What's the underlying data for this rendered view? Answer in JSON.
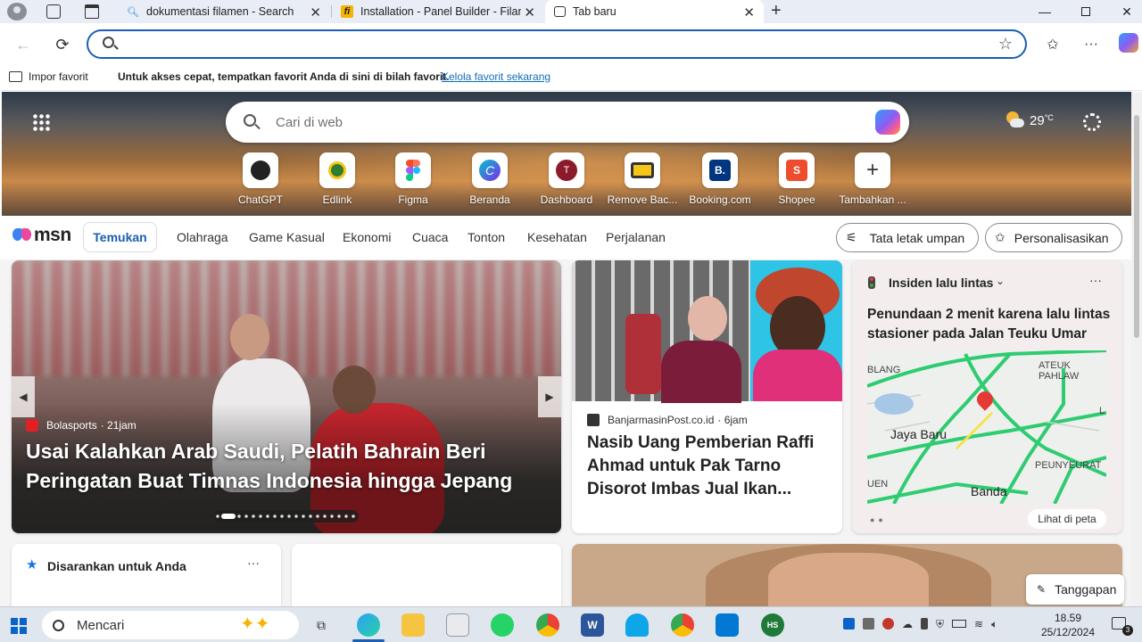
{
  "tabs": [
    {
      "title": "dokumentasi filamen - Search",
      "icon": "bing-search-icon"
    },
    {
      "title": "Installation - Panel Builder - Filam",
      "icon": "filament-icon"
    },
    {
      "title": "Tab baru",
      "icon": "new-tab-icon"
    }
  ],
  "address": {
    "value": "",
    "placeholder": ""
  },
  "favbar": {
    "import": "Impor favorit",
    "hint": "Untuk akses cepat, tempatkan favorit Anda di sini di bilah favorit.",
    "manage_link": "Kelola favorit sekarang"
  },
  "hero": {
    "search_placeholder": "Cari di web",
    "weather": {
      "temp": "29",
      "unit": "°C"
    },
    "quicklinks": [
      {
        "label": "ChatGPT",
        "icon": "chatgpt-icon"
      },
      {
        "label": "Edlink",
        "icon": "edlink-icon"
      },
      {
        "label": "Figma",
        "icon": "figma-icon"
      },
      {
        "label": "Beranda",
        "icon": "canva-icon"
      },
      {
        "label": "Dashboard",
        "icon": "t-icon"
      },
      {
        "label": "Remove Bac...",
        "icon": "removebg-icon"
      },
      {
        "label": "Booking.com",
        "icon": "booking-icon"
      },
      {
        "label": "Shopee",
        "icon": "shopee-icon"
      },
      {
        "label": "Tambahkan ...",
        "icon": "plus-icon"
      }
    ]
  },
  "msn": {
    "logo": "msn",
    "nav": [
      "Temukan",
      "Olahraga",
      "Game Kasual",
      "Ekonomi",
      "Cuaca",
      "Tonton",
      "Kesehatan",
      "Perjalanan"
    ],
    "layout_btn": "Tata letak umpan",
    "personalize_btn": "Personalisasikan"
  },
  "main_card": {
    "source": "Bolasports",
    "time": "· 21jam",
    "headline": "Usai Kalahkan Arab Saudi, Pelatih Bahrain Beri Peringatan Buat Timnas Indonesia hingga Jepang"
  },
  "card2": {
    "source": "BanjarmasinPost.co.id",
    "time": "· 6jam",
    "headline": "Nasib Uang Pemberian Raffi Ahmad untuk Pak Tarno Disorot Imbas Jual Ikan..."
  },
  "traffic": {
    "title": "Insiden lalu lintas",
    "headline": "Penundaan 2 menit karena lalu lintas stasioner pada Jalan Teuku Umar",
    "map_labels": [
      "BLANG",
      "ATEUK PAHLAW",
      "Jaya Baru",
      "PEUNYEURAT",
      "UEN",
      "Banda",
      "L"
    ],
    "map_link": "Lihat di peta"
  },
  "suggested": {
    "title": "Disarankan untuk Anda"
  },
  "feedback": "Tanggapan",
  "taskbar": {
    "search": "Mencari",
    "time": "18.59",
    "date": "25/12/2024",
    "notif_count": "3"
  },
  "colors": {
    "accent": "#1a5fb4",
    "link": "#0f6cbd",
    "traffic_green": "#2ecc71"
  }
}
